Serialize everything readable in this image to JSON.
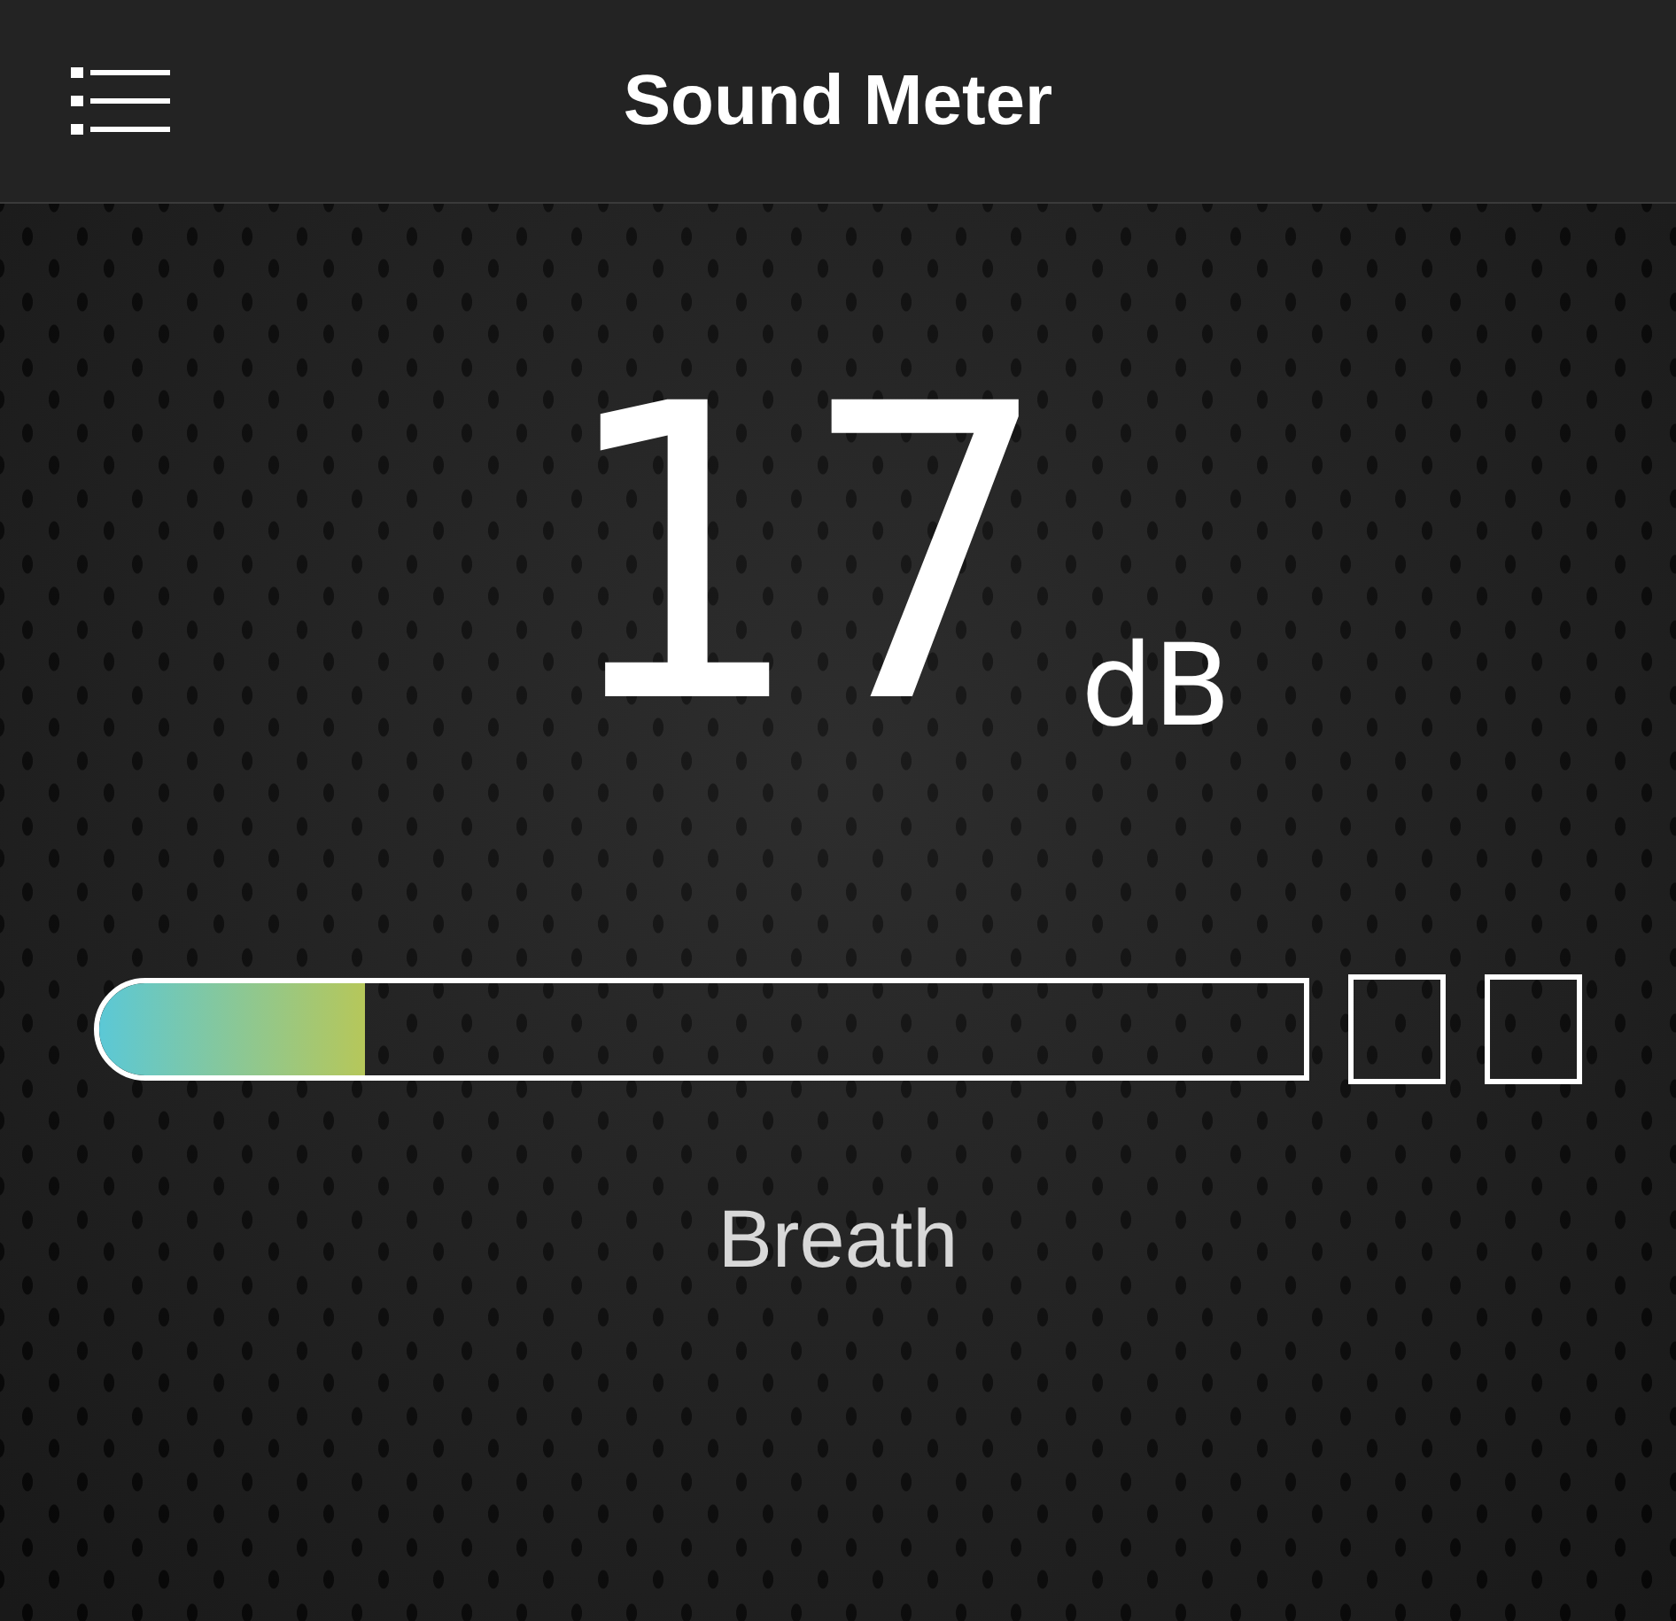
{
  "header": {
    "title": "Sound Meter"
  },
  "reading": {
    "value": "17",
    "unit": "dB"
  },
  "meter": {
    "level": 0.22
  },
  "label": "Breath"
}
